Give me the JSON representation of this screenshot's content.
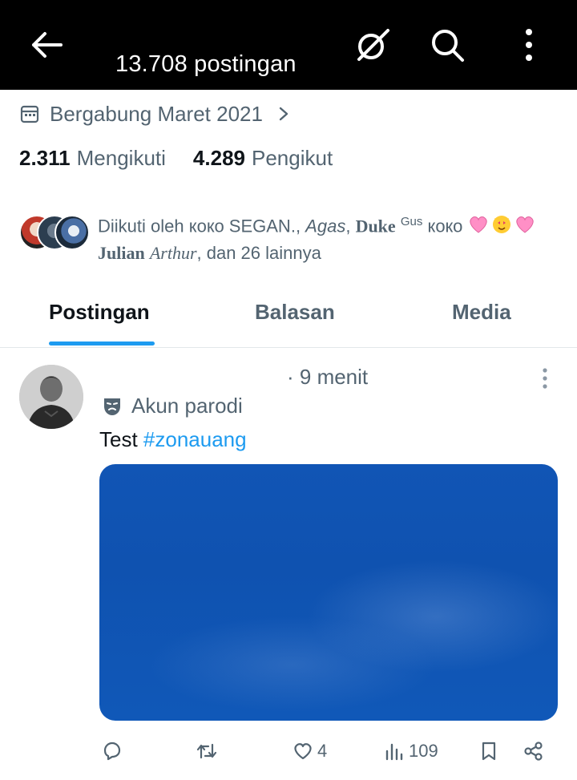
{
  "header": {
    "title": "13.708 postingan",
    "back_icon": "back-arrow-icon",
    "grok_icon": "grok-icon",
    "search_icon": "search-icon",
    "more_icon": "more-vertical-icon"
  },
  "profile": {
    "joined": "Bergabung Maret 2021",
    "following_count": "2.311",
    "following_label": "Mengikuti",
    "followers_count": "4.289",
    "followers_label": "Pengikut",
    "followed_by": {
      "prefix": "Diikuti oleh ",
      "name1": "кокo SEGAN.",
      "sep1": ", ",
      "name2": "Agas",
      "sep2": ", ",
      "name3": "Duke",
      "name3_sup": "Gus",
      "name3_suffix": " кокo ",
      "name4a": "Julian",
      "name4b": "Arthur",
      "suffix": ", dan 26 lainnya"
    }
  },
  "tabs": [
    {
      "label": "Postingan",
      "active": true
    },
    {
      "label": "Balasan",
      "active": false
    },
    {
      "label": "Media",
      "active": false
    }
  ],
  "post": {
    "time": "· 9 menit",
    "parody_label": "Akun parodi",
    "text": "Test ",
    "hashtag": "#zonauang",
    "likes": "4",
    "views": "109"
  },
  "colors": {
    "accent": "#1d9bf0",
    "secondary_text": "#536471",
    "header_bg": "#000000"
  }
}
